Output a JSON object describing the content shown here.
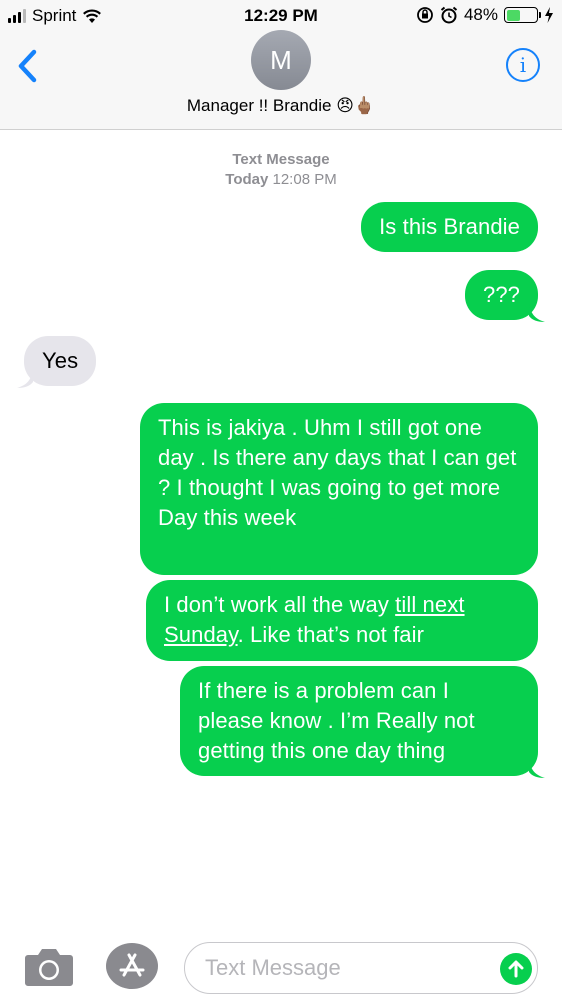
{
  "status_bar": {
    "carrier": "Sprint",
    "time": "12:29 PM",
    "battery": "48%",
    "battery_level": 0.48
  },
  "header": {
    "back_icon": "chevron-left-icon",
    "avatar_initial": "M",
    "contact_name": "Manager !! Brandie 😠🖕🏽",
    "info_icon": "info-icon",
    "info_glyph": "i"
  },
  "thread": {
    "service_label": "Text Message",
    "date_label": "Today",
    "time_label": "12:08 PM"
  },
  "messages": [
    {
      "direction": "sent",
      "text": "Is this Brandie"
    },
    {
      "direction": "sent",
      "text": "???"
    },
    {
      "direction": "received",
      "text": "Yes"
    },
    {
      "direction": "sent",
      "text": "This is jakiya . Uhm I still got one day . Is there any days that I can get ? I thought I was going to get more Day this week"
    },
    {
      "direction": "sent",
      "text_before": "I don’t work all the way ",
      "link_text": "till next Sunday",
      "text_after": ". Like that’s not fair"
    },
    {
      "direction": "sent",
      "text": "If there is a problem can I please know . I’m Really not getting this one day thing"
    }
  ],
  "input_bar": {
    "camera_icon": "camera-icon",
    "apps_icon": "app-store-icon",
    "placeholder": "Text Message",
    "send_icon": "send-arrow-icon"
  },
  "colors": {
    "sent_bubble": "#07cf4e",
    "received_bubble": "#e6e5eb",
    "accent": "#1582fb"
  }
}
